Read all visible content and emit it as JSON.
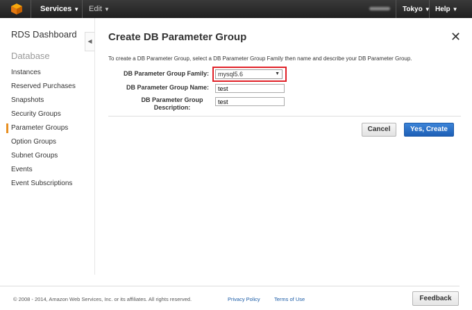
{
  "topbar": {
    "services_label": "Services",
    "edit_label": "Edit",
    "region_label": "Tokyo",
    "help_label": "Help"
  },
  "sidebar": {
    "title": "RDS Dashboard",
    "section": "Database",
    "items": [
      {
        "label": "Instances"
      },
      {
        "label": "Reserved Purchases"
      },
      {
        "label": "Snapshots"
      },
      {
        "label": "Security Groups"
      },
      {
        "label": "Parameter Groups",
        "active": true
      },
      {
        "label": "Option Groups"
      },
      {
        "label": "Subnet Groups"
      },
      {
        "label": "Events"
      },
      {
        "label": "Event Subscriptions"
      }
    ]
  },
  "dialog": {
    "title": "Create DB Parameter Group",
    "intro": "To create a DB Parameter Group, select a DB Parameter Group Family then name and describe your DB Parameter Group.",
    "family_label": "DB Parameter Group Family:",
    "family_value": "mysql5.6",
    "name_label": "DB Parameter Group Name:",
    "name_value": "test",
    "desc_label": "DB Parameter Group Description:",
    "desc_value": "test",
    "cancel_label": "Cancel",
    "create_label": "Yes, Create"
  },
  "footer": {
    "copyright": "© 2008 - 2014, Amazon Web Services, Inc. or its affiliates. All rights reserved.",
    "privacy": "Privacy Policy",
    "terms": "Terms of Use",
    "feedback": "Feedback"
  },
  "colors": {
    "topbar": "#232f3e",
    "active_marker": "#e88f21",
    "highlight_box": "#e01f26",
    "primary_button": "#2a6fc9"
  }
}
